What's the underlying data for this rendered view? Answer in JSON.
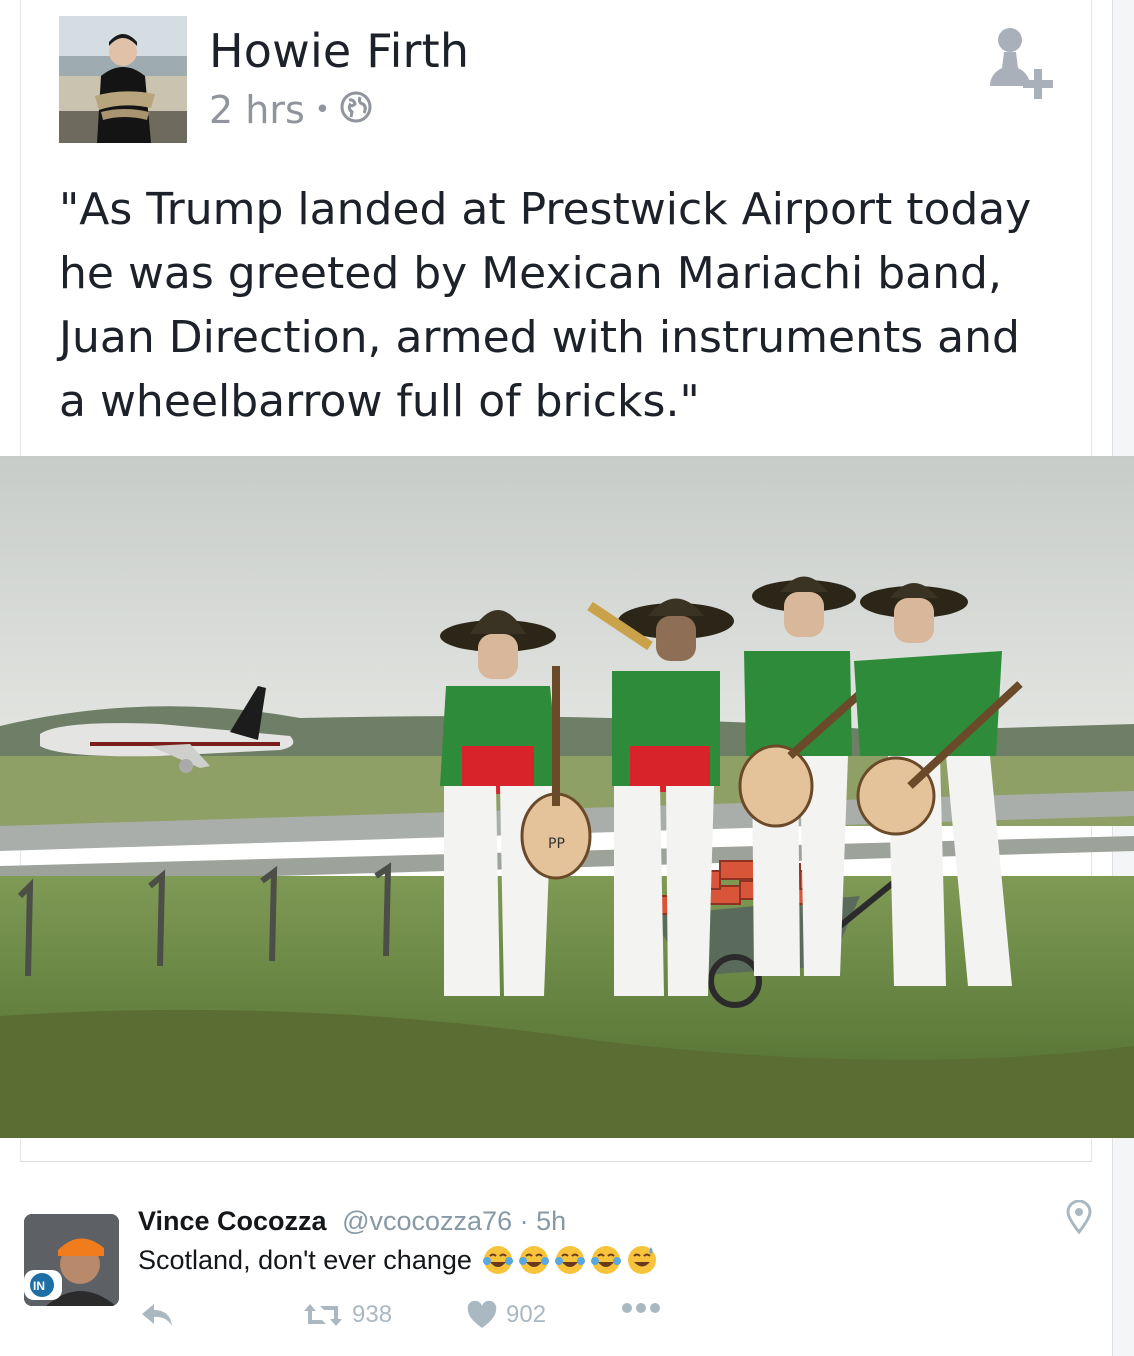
{
  "facebook_post": {
    "author": "Howie Firth",
    "time": "2 hrs",
    "separator": "•",
    "privacy_icon": "globe-icon",
    "add_friend_icon": "add-friend-icon",
    "text": "\"As Trump landed at Prestwick Airport today\nhe was greeted by Mexican Mariachi band,\nJuan Direction, armed with instruments and\na wheelbarrow full of bricks.\"",
    "photo_label": "PP"
  },
  "tweet": {
    "name": "Vince Cocozza",
    "handle": "@vcocozza76 · 5h",
    "text": "Scotland, don't ever change",
    "emojis": [
      "tears-of-joy-emoji",
      "tears-of-joy-emoji",
      "tears-of-joy-emoji",
      "tears-of-joy-emoji",
      "sweat-smile-emoji"
    ],
    "avatar_badge": "IN",
    "retweets": "938",
    "likes": "902",
    "icons": {
      "reply": "reply-icon",
      "retweet": "retweet-icon",
      "like": "heart-icon",
      "more": "more-icon",
      "location": "location-pin-icon"
    }
  },
  "colors": {
    "fb_name": "#1d2129",
    "fb_meta": "#90949c",
    "tw_gray": "#aab8c2"
  }
}
